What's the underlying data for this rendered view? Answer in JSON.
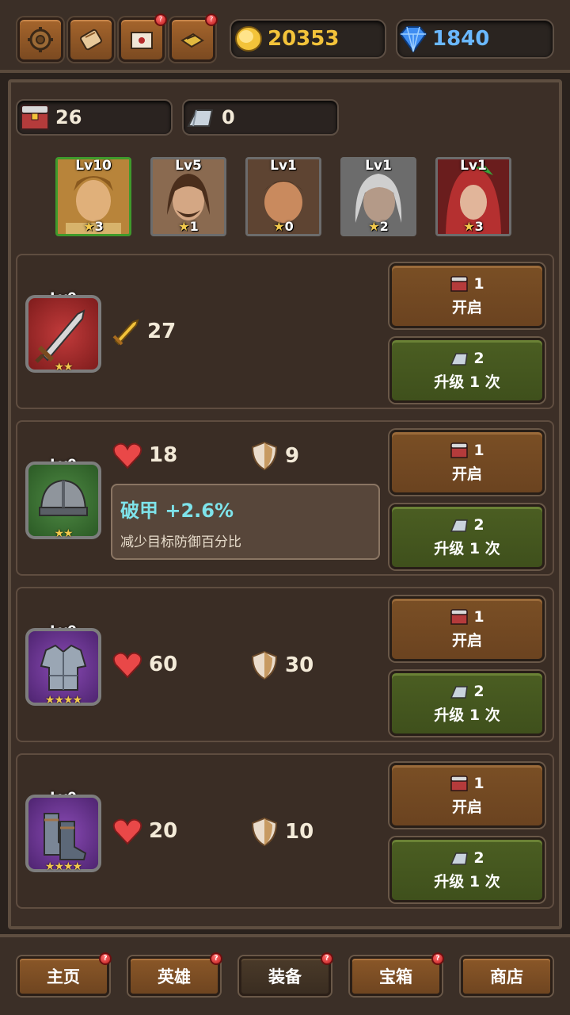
{
  "top": {
    "gold": "20353",
    "gems": "1840",
    "buttons": [
      {
        "icon": "gear-icon",
        "badge": false
      },
      {
        "icon": "scroll-icon",
        "badge": false
      },
      {
        "icon": "mail-icon",
        "badge": true
      },
      {
        "icon": "book-icon",
        "badge": true
      }
    ],
    "colors": {
      "gold": "#f3c33a",
      "gems": "#6ab8ff"
    }
  },
  "resources": {
    "chests": "26",
    "stones": "0"
  },
  "heroes": [
    {
      "level": "Lv10",
      "stars": "3",
      "selected": true
    },
    {
      "level": "Lv5",
      "stars": "1",
      "selected": false
    },
    {
      "level": "Lv1",
      "stars": "0",
      "selected": false
    },
    {
      "level": "Lv1",
      "stars": "2",
      "selected": false
    },
    {
      "level": "Lv1",
      "stars": "3",
      "selected": false
    }
  ],
  "equipment": [
    {
      "name": "sword",
      "level": "Lv0",
      "stars": "★★",
      "attack": "27",
      "open_cost": "1",
      "open_label": "开启",
      "upgrade_cost": "2",
      "upgrade_label": "升级 1 次"
    },
    {
      "name": "helmet",
      "level": "Lv0",
      "stars": "★★",
      "hp": "18",
      "defense": "9",
      "open_cost": "1",
      "open_label": "开启",
      "upgrade_cost": "2",
      "upgrade_label": "升级 1 次"
    },
    {
      "name": "armor",
      "level": "Lv0",
      "stars": "★★★★",
      "hp": "60",
      "defense": "30",
      "open_cost": "1",
      "open_label": "开启",
      "upgrade_cost": "2",
      "upgrade_label": "升级 1 次"
    },
    {
      "name": "boots",
      "level": "Lv0",
      "stars": "★★★★",
      "hp": "20",
      "defense": "10",
      "open_cost": "1",
      "open_label": "开启",
      "upgrade_cost": "2",
      "upgrade_label": "升级 1 次"
    }
  ],
  "tooltip": {
    "title": "破甲 +2.6%",
    "desc": "减少目标防御百分比"
  },
  "nav": [
    {
      "label": "主页",
      "badge": true,
      "active": false
    },
    {
      "label": "英雄",
      "badge": true,
      "active": false
    },
    {
      "label": "装备",
      "badge": true,
      "active": true
    },
    {
      "label": "宝箱",
      "badge": true,
      "active": false
    },
    {
      "label": "商店",
      "badge": false,
      "active": false
    }
  ]
}
